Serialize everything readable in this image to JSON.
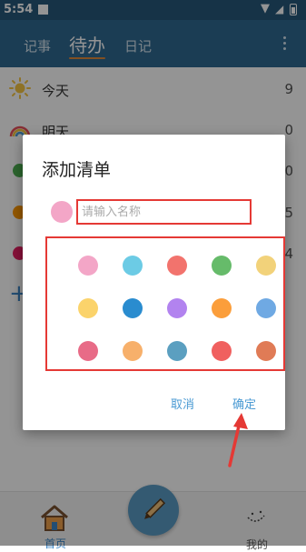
{
  "status_bar": {
    "time": "5:54"
  },
  "header": {
    "tabs": [
      {
        "label": "记事"
      },
      {
        "label": "待办"
      },
      {
        "label": "日记"
      }
    ]
  },
  "lists": [
    {
      "label": "今天",
      "count": "9",
      "icon": "sun-icon"
    },
    {
      "label": "明天",
      "count": "0",
      "icon": "rainbow-icon"
    },
    {
      "label": "",
      "count": "0",
      "color": "#4caf50"
    },
    {
      "label": "",
      "count": "5",
      "color": "#ff9800"
    },
    {
      "label": "",
      "count": "4",
      "color": "#e91e63"
    }
  ],
  "bottom_nav": {
    "home_label": "首页",
    "mine_label": "我的"
  },
  "dialog": {
    "title": "添加清单",
    "input_placeholder": "请输入名称",
    "input_value": "",
    "selected_color": "#f3a6c7",
    "colors": [
      "#f3a6c7",
      "#6ccbe5",
      "#f2736d",
      "#66bb6a",
      "#f2d27a",
      "#fbd36b",
      "#2a8ccf",
      "#b283ef",
      "#fb9e3b",
      "#6fa9e3",
      "#e86b87",
      "#f7b06b",
      "#5b9fc0",
      "#f0605f",
      "#e07b56"
    ],
    "cancel_label": "取消",
    "confirm_label": "确定"
  },
  "colors": {
    "status_bar": "#27587a",
    "header": "#2f6991",
    "accent": "#4a9ad3",
    "highlight_box": "#e53935"
  }
}
